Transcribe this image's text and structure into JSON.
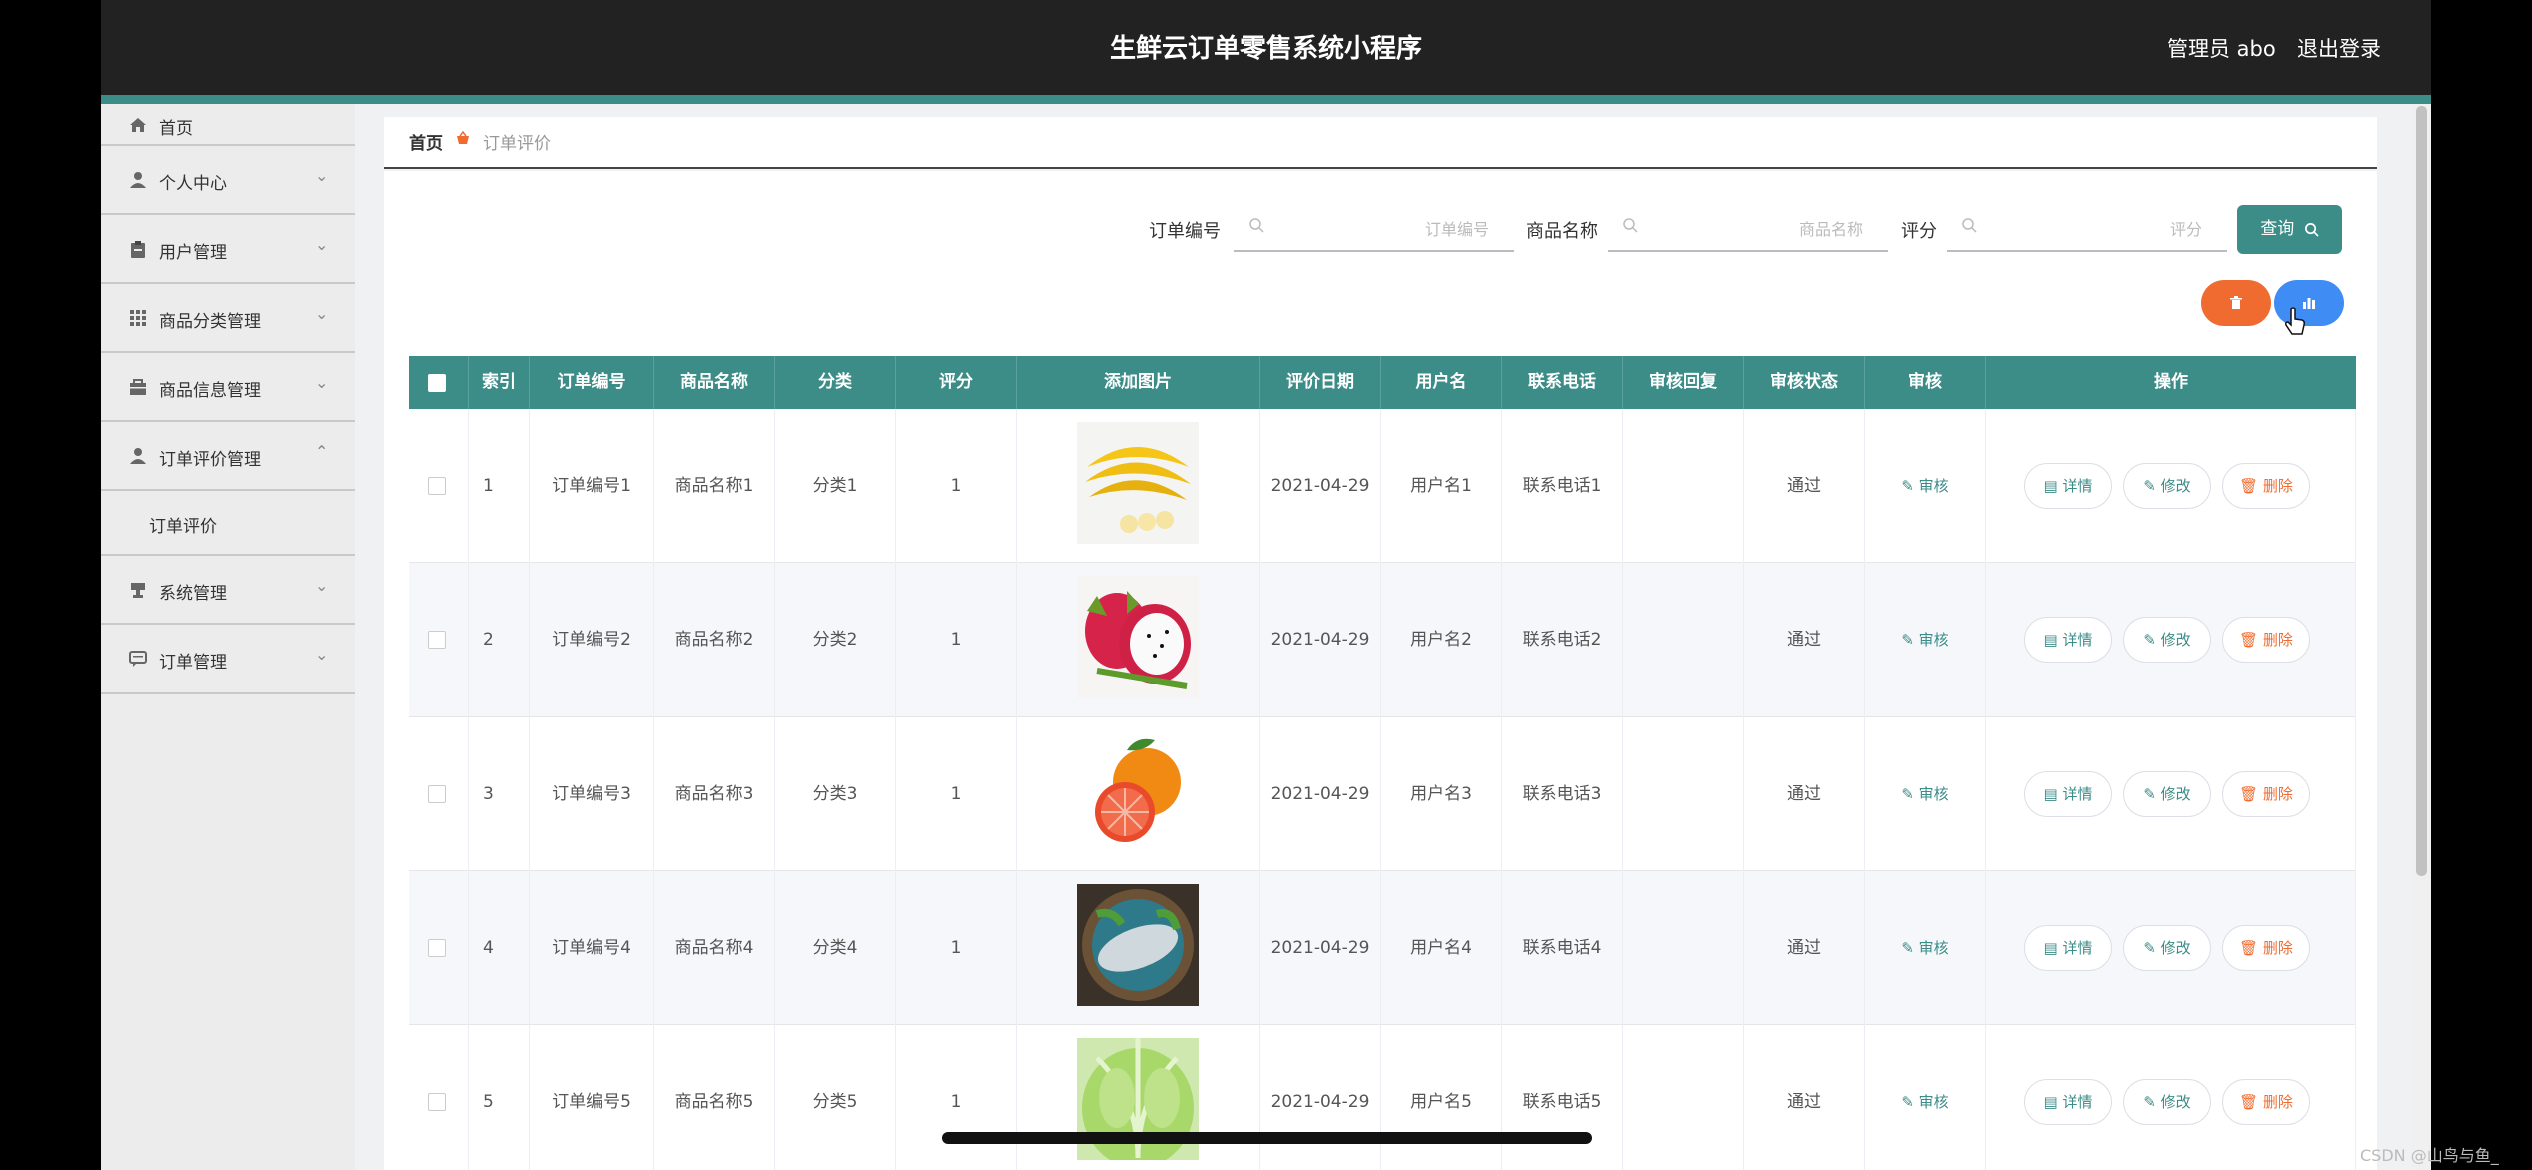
{
  "header": {
    "title": "生鲜云订单零售系统小程序",
    "user": "管理员 abo",
    "logout": "退出登录"
  },
  "sidebar": {
    "items": [
      {
        "label": "首页",
        "icon": "home-icon"
      },
      {
        "label": "个人中心",
        "icon": "person-icon"
      },
      {
        "label": "用户管理",
        "icon": "clipboard-icon"
      },
      {
        "label": "商品分类管理",
        "icon": "grid-icon"
      },
      {
        "label": "商品信息管理",
        "icon": "shop-icon"
      },
      {
        "label": "订单评价管理",
        "icon": "person-icon"
      },
      {
        "label": "系统管理",
        "icon": "cup-icon"
      },
      {
        "label": "订单管理",
        "icon": "chat-icon"
      }
    ],
    "sub_item": "订单评价"
  },
  "breadcrumb": {
    "home": "首页",
    "current": "订单评价"
  },
  "search": {
    "order_no_label": "订单编号",
    "order_no_placeholder": "订单编号",
    "product_label": "商品名称",
    "product_placeholder": "商品名称",
    "score_label": "评分",
    "score_placeholder": "评分",
    "query_label": "查询"
  },
  "table": {
    "headers": [
      "索引",
      "订单编号",
      "商品名称",
      "分类",
      "评分",
      "添加图片",
      "评价日期",
      "用户名",
      "联系电话",
      "审核回复",
      "审核状态",
      "审核",
      "操作"
    ],
    "rows": [
      {
        "index": "1",
        "order_no": "订单编号1",
        "product": "商品名称1",
        "category": "分类1",
        "score": "1",
        "date": "2021-04-29",
        "user": "用户名1",
        "phone": "联系电话1",
        "reply": "",
        "status": "通过",
        "image": "bananas"
      },
      {
        "index": "2",
        "order_no": "订单编号2",
        "product": "商品名称2",
        "category": "分类2",
        "score": "1",
        "date": "2021-04-29",
        "user": "用户名2",
        "phone": "联系电话2",
        "reply": "",
        "status": "通过",
        "image": "dragon fruit"
      },
      {
        "index": "3",
        "order_no": "订单编号3",
        "product": "商品名称3",
        "category": "分类3",
        "score": "1",
        "date": "2021-04-29",
        "user": "用户名3",
        "phone": "联系电话3",
        "reply": "",
        "status": "通过",
        "image": "grapefruit"
      },
      {
        "index": "4",
        "order_no": "订单编号4",
        "product": "商品名称4",
        "category": "分类4",
        "score": "1",
        "date": "2021-04-29",
        "user": "用户名4",
        "phone": "联系电话4",
        "reply": "",
        "status": "通过",
        "image": "fish"
      },
      {
        "index": "5",
        "order_no": "订单编号5",
        "product": "商品名称5",
        "category": "分类5",
        "score": "1",
        "date": "2021-04-29",
        "user": "用户名5",
        "phone": "联系电话5",
        "reply": "",
        "status": "通过",
        "image": "cabbage"
      }
    ],
    "audit_label": "审核",
    "detail_label": "详情",
    "edit_label": "修改",
    "delete_label": "删除"
  },
  "watermark": "CSDN @山鸟与鱼_",
  "colors": {
    "accent": "#3c8c88",
    "danger": "#f06b2f",
    "primary": "#3e8cf4",
    "header_bg": "#222222"
  }
}
